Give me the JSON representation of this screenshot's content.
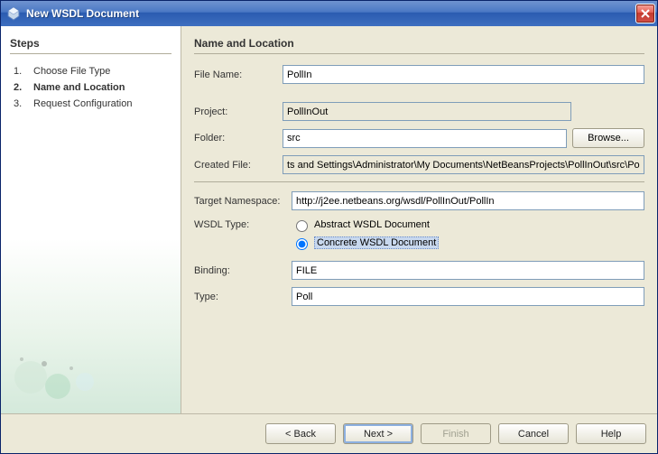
{
  "window": {
    "title": "New WSDL Document"
  },
  "sidebar": {
    "heading": "Steps",
    "steps": [
      {
        "num": "1.",
        "label": "Choose File Type"
      },
      {
        "num": "2.",
        "label": "Name and Location"
      },
      {
        "num": "3.",
        "label": "Request Configuration"
      }
    ],
    "current_index": 1
  },
  "main": {
    "heading": "Name and Location",
    "file_name_label": "File Name:",
    "file_name_value": "PollIn",
    "project_label": "Project:",
    "project_value": "PollInOut",
    "folder_label": "Folder:",
    "folder_value": "src",
    "browse_label": "Browse...",
    "created_file_label": "Created File:",
    "created_file_value": "ts and Settings\\Administrator\\My Documents\\NetBeansProjects\\PollInOut\\src\\PollIn.wsdl",
    "target_ns_label": "Target Namespace:",
    "target_ns_value": "http://j2ee.netbeans.org/wsdl/PollInOut/PollIn",
    "wsdl_type_label": "WSDL Type:",
    "wsdl_type_options": {
      "abstract": "Abstract WSDL Document",
      "concrete": "Concrete WSDL Document"
    },
    "wsdl_type_selected": "concrete",
    "binding_label": "Binding:",
    "binding_value": "FILE",
    "type_label": "Type:",
    "type_value": "Poll"
  },
  "footer": {
    "back": "< Back",
    "next": "Next >",
    "finish": "Finish",
    "cancel": "Cancel",
    "help": "Help"
  }
}
